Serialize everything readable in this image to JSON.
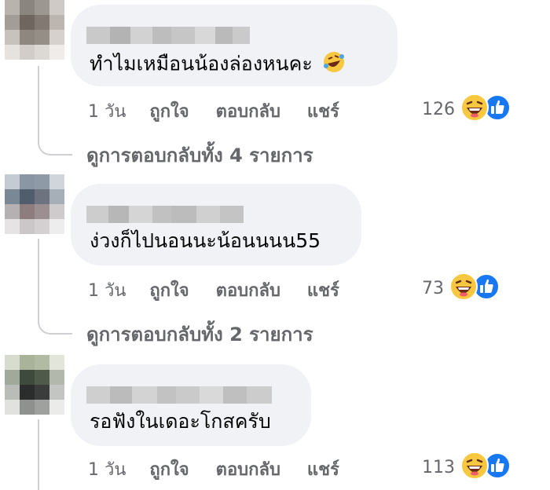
{
  "comments": [
    {
      "text": "ทำไมเหมือนน้องล่องหนคะ",
      "time": "1 วัน",
      "like_label": "ถูกใจ",
      "reply_label": "ตอบกลับ",
      "share_label": "แชร์",
      "reaction_count": "126",
      "replies_link": "ดูการตอบกลับทั้ง 4 รายการ",
      "inline_emoji": "rolling-laughing-emoji"
    },
    {
      "text": "ง่วงก็ไปนอนนะน้อนนนน55",
      "time": "1 วัน",
      "like_label": "ถูกใจ",
      "reply_label": "ตอบกลับ",
      "share_label": "แชร์",
      "reaction_count": "73",
      "replies_link": "ดูการตอบกลับทั้ง 2 รายการ"
    },
    {
      "text": "รอฟังในเดอะโกสครับ",
      "time": "1 วัน",
      "like_label": "ถูกใจ",
      "reply_label": "ตอบกลับ",
      "share_label": "แชร์",
      "reaction_count": "113"
    }
  ],
  "colors": {
    "bubble_bg": "#f0f2f5",
    "secondary_text": "#65676b",
    "like_blue": "#1877f2",
    "haha_yellow": "#f7c740"
  },
  "icons": [
    "haha-reaction-icon",
    "like-reaction-icon",
    "rolling-laughing-emoji"
  ]
}
